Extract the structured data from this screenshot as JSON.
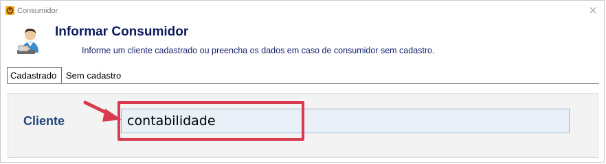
{
  "window": {
    "title": "Consumidor",
    "app_icon": "app-logo-icon",
    "close_icon": "close-icon"
  },
  "header": {
    "title": "Informar Consumidor",
    "subtitle": "Informe um cliente cadastrado ou preencha os dados em caso de consumidor sem cadastro.",
    "avatar_icon": "user-at-desk-icon"
  },
  "tabs": [
    {
      "label": "Cadastrado",
      "active": true
    },
    {
      "label": "Sem cadastro",
      "active": false
    }
  ],
  "form": {
    "cliente_label": "Cliente",
    "cliente_value": "contabilidade"
  },
  "annotation": {
    "color": "#d93a4e",
    "arrow_icon": "pointer-arrow-icon"
  },
  "colors": {
    "header_title": "#0a1a5c",
    "field_label": "#23467a",
    "input_bg": "#e9f0f8"
  }
}
